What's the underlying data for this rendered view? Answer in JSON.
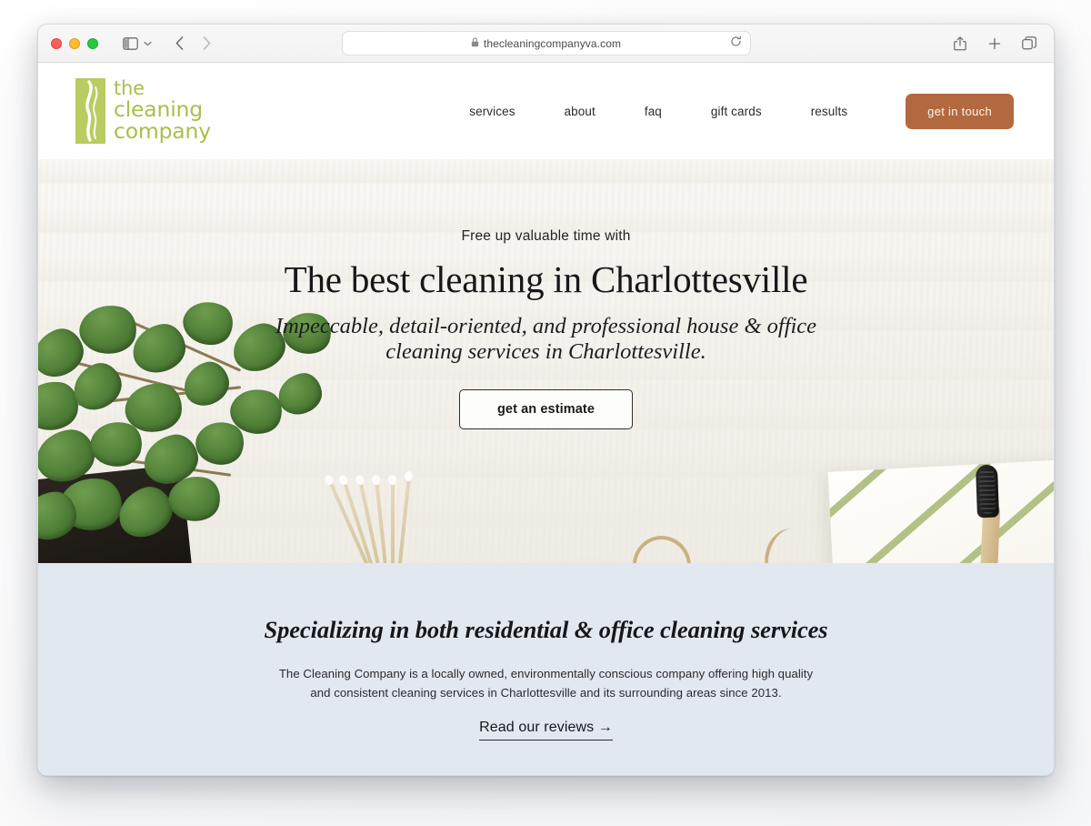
{
  "browser": {
    "url": "thecleaningcompanyva.com",
    "lock_icon": "lock-icon",
    "reload_icon": "reload-icon",
    "sidebar_icon": "sidebar-toggle-icon",
    "chevron_icon": "chevron-down-icon",
    "back_icon": "back-arrow-icon",
    "forward_icon": "forward-arrow-icon",
    "share_icon": "share-icon",
    "new_tab_icon": "plus-icon",
    "tabs_icon": "tab-overview-icon",
    "traffic_lights": [
      "close",
      "minimize",
      "maximize"
    ]
  },
  "site": {
    "logo": {
      "line1": "the",
      "line2": "cleaning",
      "line3": "company",
      "mark_color": "#b9cc61",
      "text_color": "#a8bf4e"
    },
    "nav": {
      "items": [
        {
          "label": "services"
        },
        {
          "label": "about"
        },
        {
          "label": "faq"
        },
        {
          "label": "gift cards"
        },
        {
          "label": "results"
        }
      ],
      "cta_label": "get in touch",
      "cta_color": "#b2693f"
    },
    "hero": {
      "eyebrow": "Free up valuable time with",
      "title": "The best cleaning in Charlottesville",
      "subtitle_line1": "Impeccable, detail-oriented, and professional house & office",
      "subtitle_line2": "cleaning services in Charlottesville.",
      "button_label": "get an estimate"
    },
    "intro": {
      "title": "Specializing in both residential & office cleaning services",
      "body_line1": "The Cleaning Company is a locally owned, environmentally conscious company offering high quality and",
      "body_line2": "consistent cleaning services in Charlottesville and its surrounding areas since 2013.",
      "link_label": "Read our reviews →",
      "background_color": "#e2e8ef"
    }
  }
}
